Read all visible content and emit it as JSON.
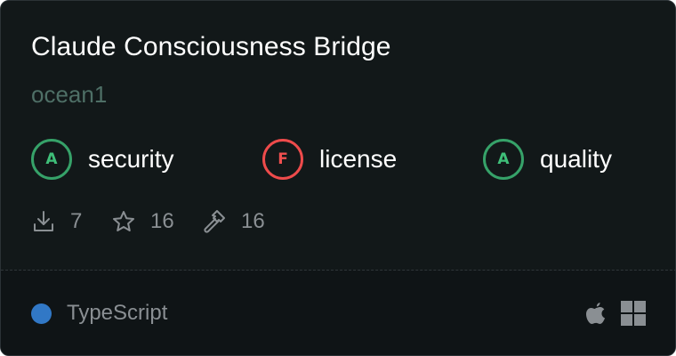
{
  "card": {
    "title": "Claude Consciousness Bridge",
    "owner": "ocean1"
  },
  "scores": [
    {
      "grade": "A",
      "label": "security",
      "status": "good"
    },
    {
      "grade": "F",
      "label": "license",
      "status": "bad"
    },
    {
      "grade": "A",
      "label": "quality",
      "status": "good"
    }
  ],
  "stats": {
    "downloads": {
      "icon": "download-icon",
      "value": "7"
    },
    "stars": {
      "icon": "star-icon",
      "value": "16"
    },
    "tools": {
      "icon": "hammer-icon",
      "value": "16"
    }
  },
  "footer": {
    "language": "TypeScript",
    "language_color": "#3178c6",
    "platforms": [
      "apple-icon",
      "windows-icon"
    ]
  },
  "colors": {
    "card_background": "#121819",
    "grade_good": "#36a269",
    "grade_bad": "#ee4b4b",
    "owner_text": "#4e6f66",
    "muted_text": "#8a8f93"
  }
}
